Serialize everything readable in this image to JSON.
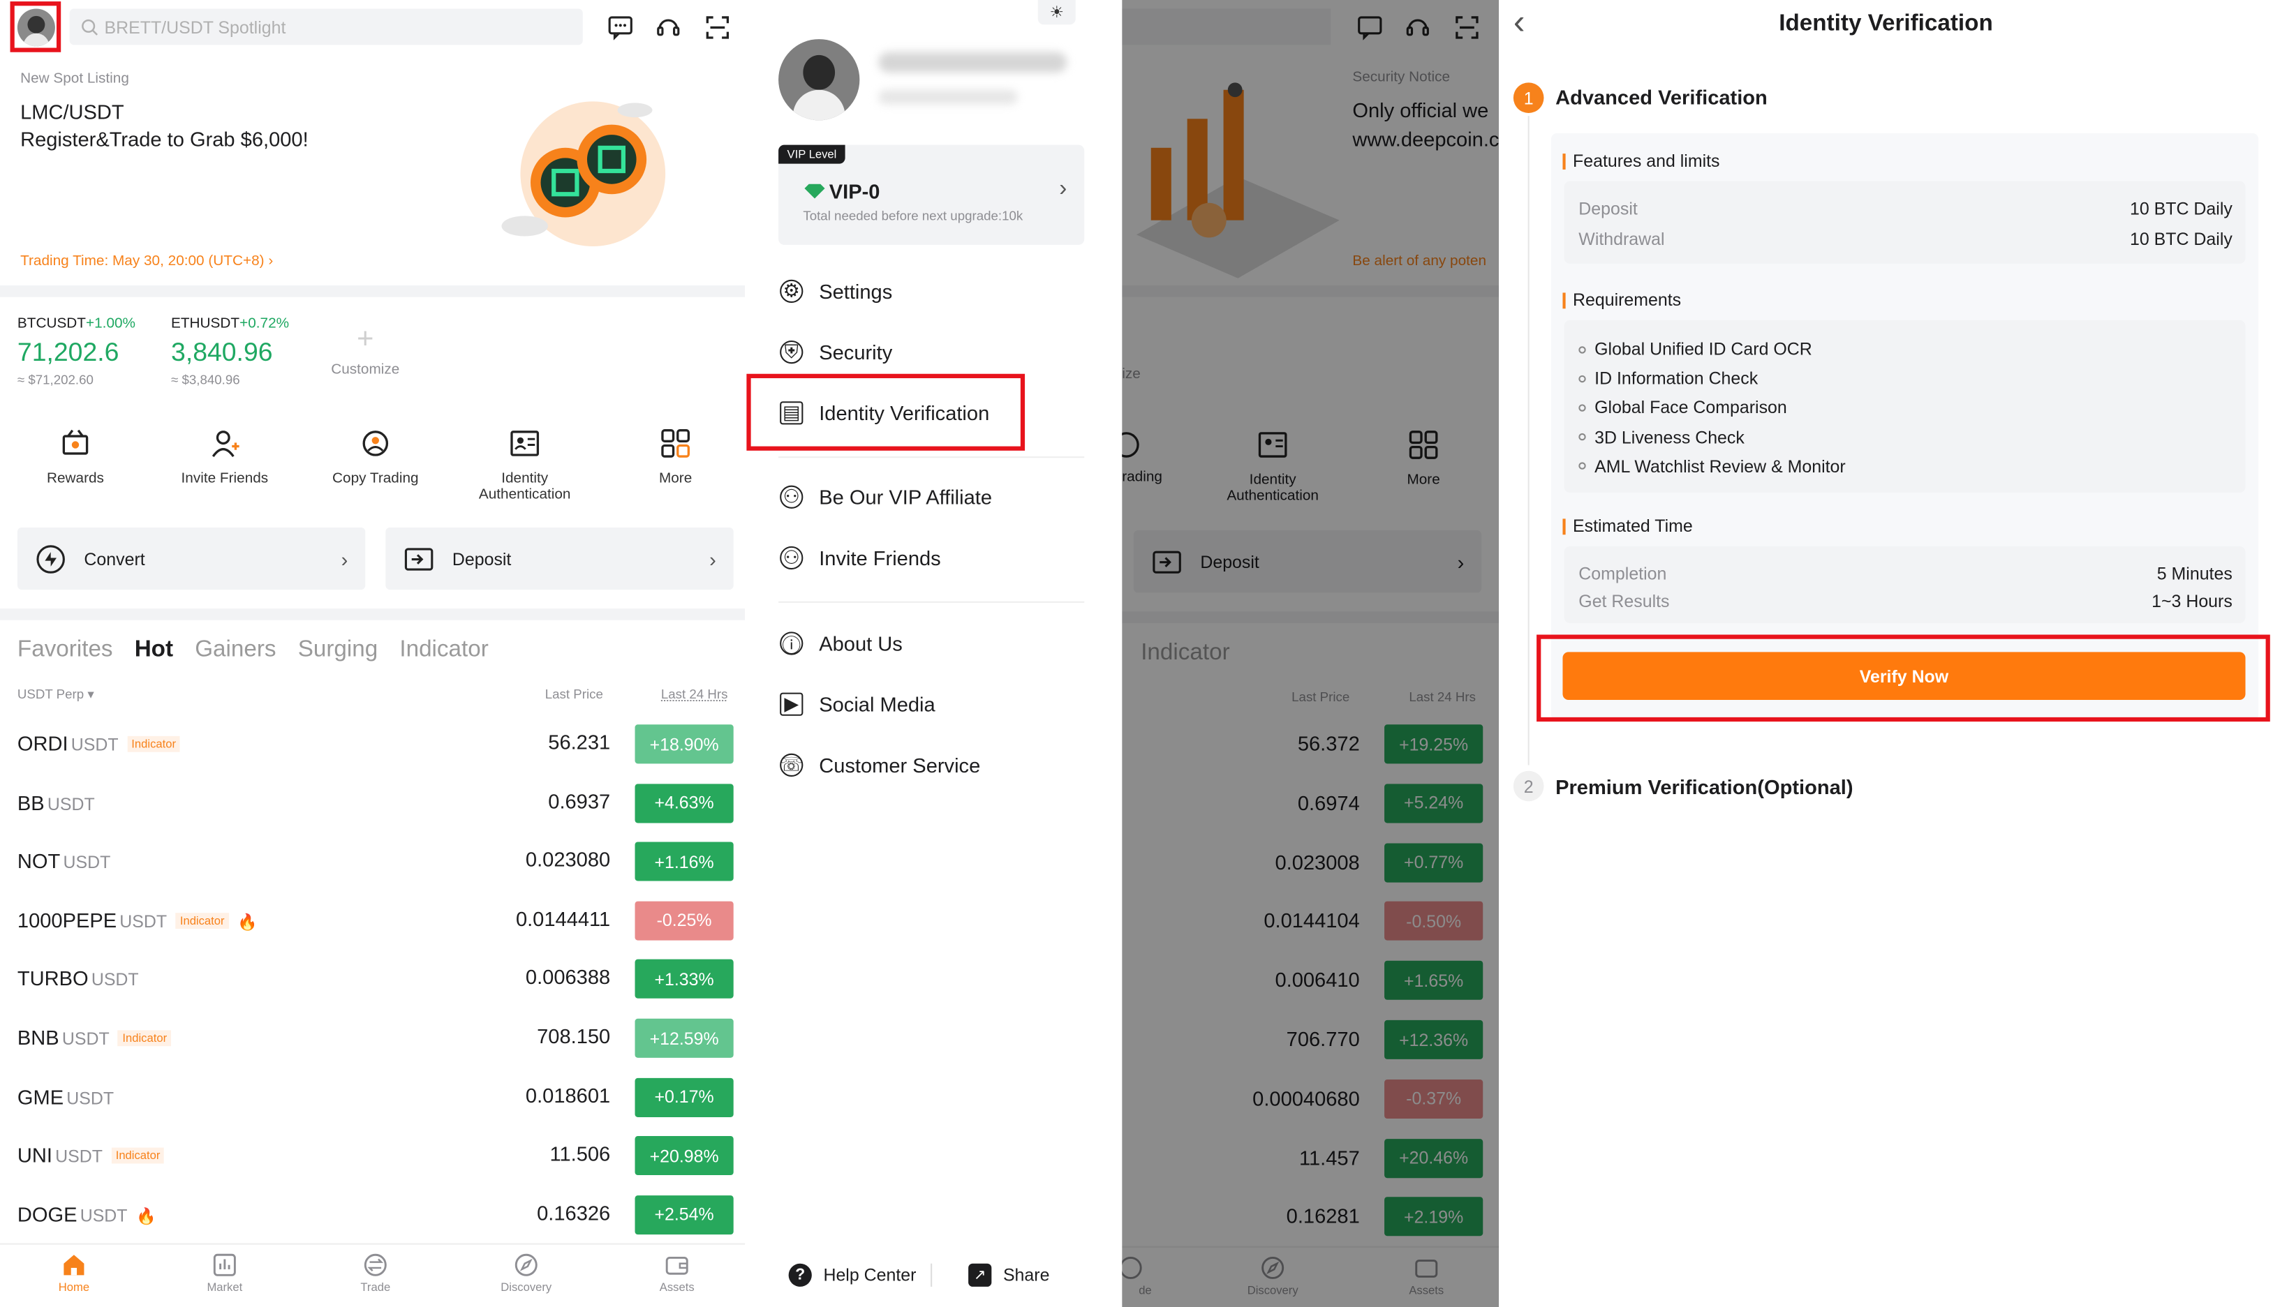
{
  "home": {
    "search_placeholder": "BRETT/USDT Spotlight",
    "listing_label": "New Spot Listing",
    "listing_pair": "LMC/USDT",
    "listing_promo": "Register&Trade to Grab $6,000!",
    "trading_time": "Trading Time: May 30, 20:00 (UTC+8) ›",
    "tickers": [
      {
        "pair": "BTCUSDT",
        "change": "+1.00%",
        "price": "71,202.6",
        "fiat": "≈ $71,202.60"
      },
      {
        "pair": "ETHUSDT",
        "change": "+0.72%",
        "price": "3,840.96",
        "fiat": "≈ $3,840.96"
      }
    ],
    "customize": "Customize",
    "quick_actions": [
      {
        "label": "Rewards"
      },
      {
        "label": "Invite Friends"
      },
      {
        "label": "Copy Trading"
      },
      {
        "label": "Identity Authentication"
      },
      {
        "label": "More"
      }
    ],
    "convert": "Convert",
    "deposit": "Deposit",
    "market_tabs": [
      "Favorites",
      "Hot",
      "Gainers",
      "Surging",
      "Indicator"
    ],
    "active_tab": "Hot",
    "filter": "USDT Perp ▾",
    "col_last_price": "Last Price",
    "col_24h": "Last 24 Hrs",
    "rows": [
      {
        "base": "ORDI",
        "quote": "USDT",
        "tag": "Indicator",
        "fire": false,
        "price": "56.231",
        "change": "+18.90%",
        "dir": "up2"
      },
      {
        "base": "BB",
        "quote": "USDT",
        "tag": "",
        "fire": false,
        "price": "0.6937",
        "change": "+4.63%",
        "dir": "up"
      },
      {
        "base": "NOT",
        "quote": "USDT",
        "tag": "",
        "fire": false,
        "price": "0.023080",
        "change": "+1.16%",
        "dir": "up"
      },
      {
        "base": "1000PEPE",
        "quote": "USDT",
        "tag": "Indicator",
        "fire": true,
        "price": "0.0144411",
        "change": "-0.25%",
        "dir": "dn"
      },
      {
        "base": "TURBO",
        "quote": "USDT",
        "tag": "",
        "fire": false,
        "price": "0.006388",
        "change": "+1.33%",
        "dir": "up"
      },
      {
        "base": "BNB",
        "quote": "USDT",
        "tag": "Indicator",
        "fire": false,
        "price": "708.150",
        "change": "+12.59%",
        "dir": "up2"
      },
      {
        "base": "GME",
        "quote": "USDT",
        "tag": "",
        "fire": false,
        "price": "0.018601",
        "change": "+0.17%",
        "dir": "up"
      },
      {
        "base": "UNI",
        "quote": "USDT",
        "tag": "Indicator",
        "fire": false,
        "price": "11.506",
        "change": "+20.98%",
        "dir": "up"
      },
      {
        "base": "DOGE",
        "quote": "USDT",
        "tag": "",
        "fire": true,
        "price": "0.16326",
        "change": "+2.54%",
        "dir": "up"
      }
    ],
    "nav": [
      "Home",
      "Market",
      "Trade",
      "Discovery",
      "Assets"
    ]
  },
  "drawer": {
    "vip_badge": "VIP Level",
    "vip_level": "VIP-0",
    "vip_note": "Total needed before next upgrade:10k",
    "menu": [
      "Settings",
      "Security",
      "Identity Verification",
      "Be Our VIP Affiliate",
      "Invite Friends",
      "About Us",
      "Social Media",
      "Customer Service"
    ],
    "help": "Help Center",
    "share": "Share"
  },
  "overlay": {
    "notice_label": "Security Notice",
    "notice_text": "Only official  we",
    "notice_url": "www.deepcoin.c",
    "alert_text": "Be alert of any poten",
    "customize": "ize",
    "qa": [
      "rading",
      "Identity Authentication",
      "More"
    ],
    "deposit": "Deposit",
    "tab": "Indicator",
    "col_last_price": "Last Price",
    "col_24h": "Last 24 Hrs",
    "rows": [
      {
        "price": "56.372",
        "change": "+19.25%",
        "dir": "up"
      },
      {
        "price": "0.6974",
        "change": "+5.24%",
        "dir": "up"
      },
      {
        "price": "0.023008",
        "change": "+0.77%",
        "dir": "up"
      },
      {
        "price": "0.0144104",
        "change": "-0.50%",
        "dir": "dn"
      },
      {
        "price": "0.006410",
        "change": "+1.65%",
        "dir": "up"
      },
      {
        "price": "706.770",
        "change": "+12.36%",
        "dir": "up"
      },
      {
        "price": "0.00040680",
        "change": "-0.37%",
        "dir": "dn"
      },
      {
        "price": "11.457",
        "change": "+20.46%",
        "dir": "up"
      },
      {
        "price": "0.16281",
        "change": "+2.19%",
        "dir": "up"
      }
    ],
    "nav": [
      "de",
      "Discovery",
      "Assets"
    ]
  },
  "verify": {
    "title": "Identity Verification",
    "step1_num": "1",
    "step1": "Advanced Verification",
    "features_label": "Features and limits",
    "deposit_label": "Deposit",
    "deposit_value": "10 BTC Daily",
    "withdraw_label": "Withdrawal",
    "withdraw_value": "10 BTC Daily",
    "req_label": "Requirements",
    "requirements": [
      "Global Unified ID Card OCR",
      "ID Information Check",
      "Global Face Comparison",
      "3D Liveness Check",
      "AML Watchlist Review & Monitor"
    ],
    "time_label": "Estimated Time",
    "completion_label": "Completion",
    "completion_value": "5 Minutes",
    "results_label": "Get Results",
    "results_value": "1~3 Hours",
    "verify_button": "Verify Now",
    "step2_num": "2",
    "step2": "Premium Verification(Optional)"
  },
  "colors": {
    "accent": "#f7821b",
    "up": "#27a85c",
    "down": "#e98a8a",
    "highlight": "#e8131c"
  }
}
